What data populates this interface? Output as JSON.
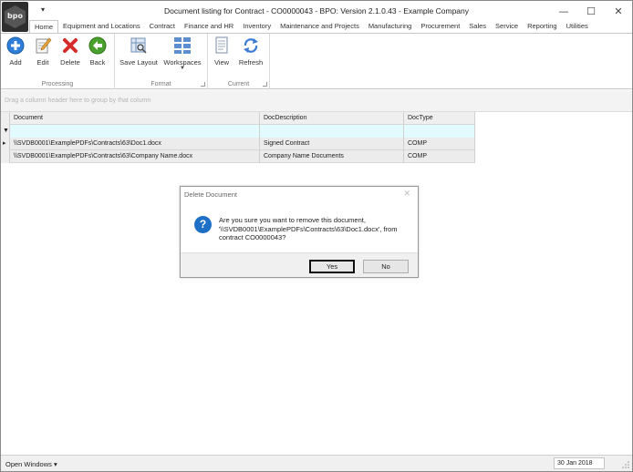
{
  "window": {
    "title": "Document listing for Contract - CO0000043 - BPO: Version 2.1.0.43 - Example Company",
    "logo_text": "bpo",
    "qat_symbol": "▾",
    "buttons": {
      "minimize": "—",
      "maximize": "☐",
      "close": "✕"
    }
  },
  "tabs": [
    "Home",
    "Equipment and Locations",
    "Contract",
    "Finance and HR",
    "Inventory",
    "Maintenance and Projects",
    "Manufacturing",
    "Procurement",
    "Sales",
    "Service",
    "Reporting",
    "Utilities"
  ],
  "ribbon": {
    "processing": {
      "label": "Processing",
      "add": "Add",
      "edit": "Edit",
      "delete": "Delete",
      "back": "Back"
    },
    "format": {
      "label": "Format",
      "save_layout": "Save Layout",
      "workspaces": "Workspaces"
    },
    "current": {
      "label": "Current",
      "view": "View",
      "refresh": "Refresh"
    }
  },
  "group_panel_hint": "Drag a column header here to group by that column",
  "grid": {
    "columns": [
      "Document",
      "DocDescription",
      "DocType"
    ],
    "filter_symbol": "▼",
    "current_row_symbol": "▸",
    "rows": [
      {
        "document": "\\\\SVDB0001\\ExamplePDFs\\Contracts\\63\\Doc1.docx",
        "description": "Signed Contract",
        "type": "COMP"
      },
      {
        "document": "\\\\SVDB0001\\ExamplePDFs\\Contracts\\63\\Company Name.docx",
        "description": "Company Name Documents",
        "type": "COMP"
      }
    ]
  },
  "dialog": {
    "title": "Delete Document",
    "close": "✕",
    "icon_text": "?",
    "message": "Are you sure you want to remove this document, '\\\\SVDB0001\\ExamplePDFs\\Contracts\\63\\Doc1.docx', from contract CO0000043?",
    "yes": "Yes",
    "no": "No"
  },
  "statusbar": {
    "open_windows": "Open Windows ▾",
    "date": "30 Jan 2018"
  }
}
